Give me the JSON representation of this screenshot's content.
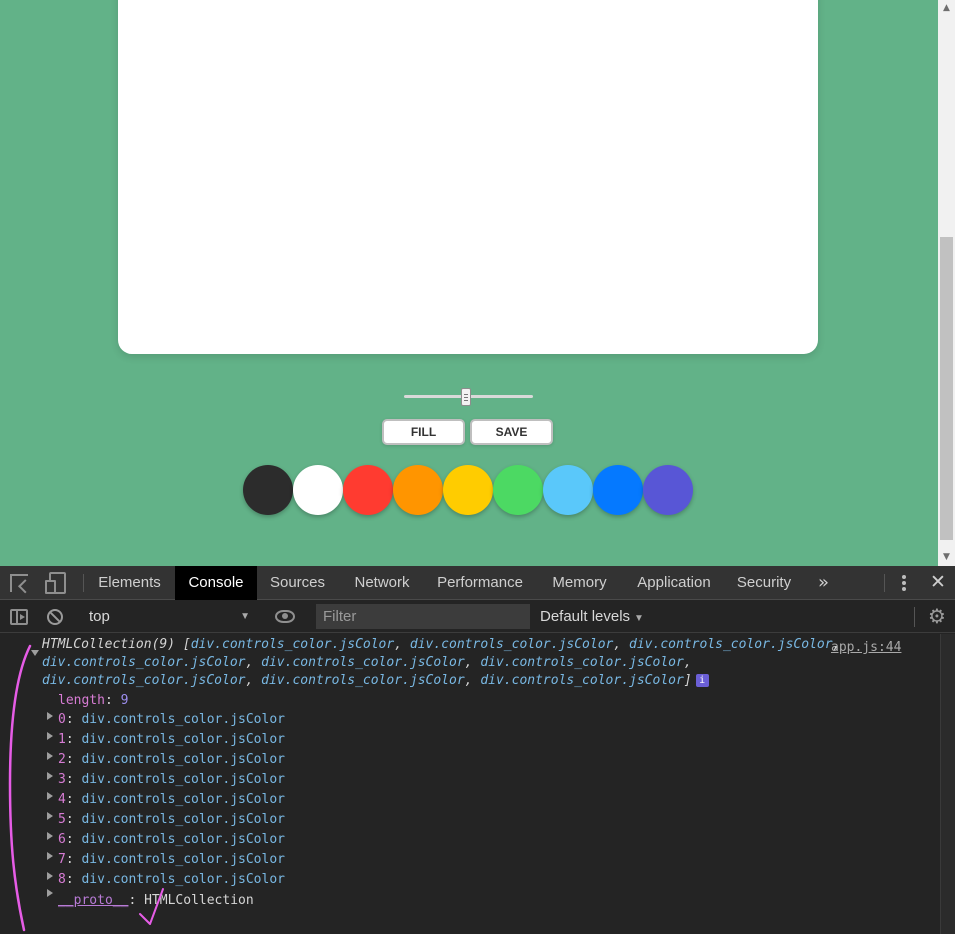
{
  "page": {
    "buttons": {
      "fill": "FILL",
      "save": "SAVE"
    },
    "brush_size_fraction": 0.48,
    "colors": [
      "#2c2c2c",
      "#ffffff",
      "#ff3b30",
      "#ff9500",
      "#ffcc00",
      "#4cd963",
      "#5ac8fa",
      "#0579ff",
      "#5856d6"
    ]
  },
  "devtools": {
    "tabs": [
      "Elements",
      "Console",
      "Sources",
      "Network",
      "Performance",
      "Memory",
      "Application",
      "Security"
    ],
    "active_tab": "Console",
    "more_tabs": "»",
    "context": "top",
    "filter_placeholder": "Filter",
    "levels": "Default levels",
    "console": {
      "source": "app.js:44",
      "header_prefix": "HTMLCollection(9) [",
      "header_item": "div.controls_color.jsColor",
      "length_key": "length",
      "length_value": "9",
      "entries": [
        {
          "index": "0",
          "value": "div.controls_color.jsColor"
        },
        {
          "index": "1",
          "value": "div.controls_color.jsColor"
        },
        {
          "index": "2",
          "value": "div.controls_color.jsColor"
        },
        {
          "index": "3",
          "value": "div.controls_color.jsColor"
        },
        {
          "index": "4",
          "value": "div.controls_color.jsColor"
        },
        {
          "index": "5",
          "value": "div.controls_color.jsColor"
        },
        {
          "index": "6",
          "value": "div.controls_color.jsColor"
        },
        {
          "index": "7",
          "value": "div.controls_color.jsColor"
        },
        {
          "index": "8",
          "value": "div.controls_color.jsColor"
        }
      ],
      "proto_key": "__proto__",
      "proto_value": "HTMLCollection",
      "info_badge": "i"
    },
    "annotation_color": "#e65ce6"
  }
}
